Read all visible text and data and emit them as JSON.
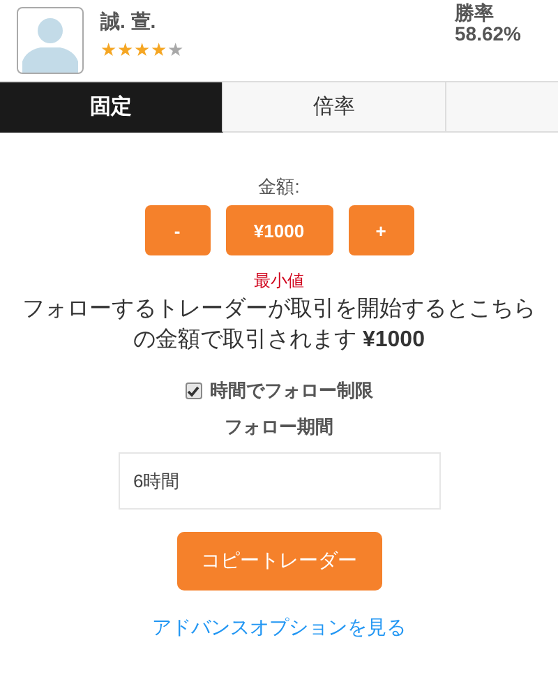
{
  "trader": {
    "name": "誠. 萱.",
    "stars": 4,
    "win_rate_label": "勝率",
    "win_rate": "58.62%"
  },
  "tabs": [
    {
      "label": "固定",
      "selected": true
    },
    {
      "label": "倍率",
      "selected": false
    }
  ],
  "amount": {
    "label": "金額:",
    "decrease": "-",
    "value": "¥1000",
    "increase": "+",
    "min_note": "最小値",
    "description": "フォローするトレーダーが取引を開始するとこちらの金額で取引されます **¥1000**"
  },
  "time_limit": {
    "label": "時間でフォロー制限",
    "checked": true
  },
  "period": {
    "label": "フォロー期間",
    "value": "6時間"
  },
  "copy_button": "コピートレーダー",
  "advanced_link": "アドバンスオプションを見る"
}
